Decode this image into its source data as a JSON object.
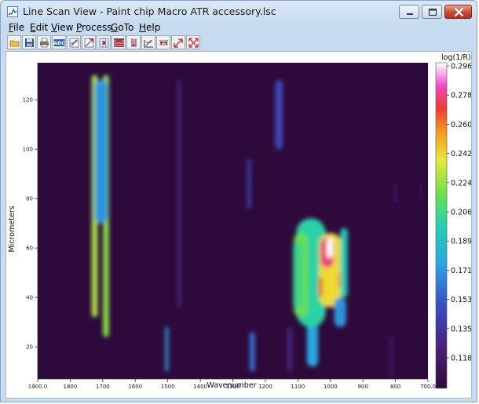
{
  "window": {
    "title": "Line Scan View - Paint chip Macro ATR accessory.lsc",
    "controls": [
      "minimize",
      "maximize",
      "close"
    ]
  },
  "menu": [
    {
      "label": "File",
      "mnemonic": "F",
      "rest": "ile"
    },
    {
      "label": "Edit",
      "mnemonic": "E",
      "rest": "dit"
    },
    {
      "label": "View",
      "mnemonic": "V",
      "rest": "iew"
    },
    {
      "label": "Process",
      "mnemonic": "P",
      "rest": "rocess"
    },
    {
      "label": "GoTo",
      "mnemonic": "G",
      "rest": "oTo"
    },
    {
      "label": "Help",
      "mnemonic": "H",
      "rest": "elp"
    }
  ],
  "toolbar": {
    "buttons": [
      "open-folder-icon",
      "save-disk-icon",
      "print-icon",
      "abc-label-icon",
      "edit-spectrum-icon",
      "zoom-window-icon",
      "grid-icon",
      "image-map-icon",
      "vertical-cursor-icon",
      "horizontal-cursor-icon",
      "axis-scale-icon",
      "horizontal-expand-icon",
      "zoom-out-icon",
      "full-scale-icon"
    ]
  },
  "chart_data": {
    "type": "heatmap",
    "xlabel": "Wavenumber",
    "ylabel": "Micrometers",
    "xlim": [
      1900.0,
      700.0
    ],
    "ylim": [
      7,
      135
    ],
    "x_ticks": [
      "1900.0",
      "1800",
      "1700",
      "1600",
      "1500",
      "1400",
      "1300",
      "1200",
      "1100",
      "1000",
      "900",
      "800",
      "700.0"
    ],
    "y_ticks": [
      20,
      40,
      60,
      80,
      100,
      120
    ],
    "grid": false,
    "colorbar": {
      "title": "log(1/R)",
      "ticks": [
        "0.296",
        "0.278",
        "0.260",
        "0.242",
        "0.224",
        "0.206",
        "0.189",
        "0.171",
        "0.153",
        "0.135",
        "0.118"
      ],
      "min": 0.1,
      "max": 0.296
    },
    "background_value": 0.1,
    "features": [
      {
        "wavenumber": 1725,
        "width": 18,
        "y_from": 32,
        "y_to": 130,
        "value": 0.228
      },
      {
        "wavenumber": 1690,
        "width": 18,
        "y_from": 24,
        "y_to": 130,
        "value": 0.222
      },
      {
        "wavenumber": 1705,
        "width": 40,
        "y_from": 70,
        "y_to": 128,
        "value": 0.17
      },
      {
        "wavenumber": 1465,
        "width": 8,
        "y_from": 36,
        "y_to": 128,
        "value": 0.13
      },
      {
        "wavenumber": 1503,
        "width": 9,
        "y_from": 10,
        "y_to": 28,
        "value": 0.175
      },
      {
        "wavenumber": 1240,
        "width": 16,
        "y_from": 10,
        "y_to": 26,
        "value": 0.16
      },
      {
        "wavenumber": 1250,
        "width": 10,
        "y_from": 76,
        "y_to": 96,
        "value": 0.145
      },
      {
        "wavenumber": 1158,
        "width": 24,
        "y_from": 100,
        "y_to": 128,
        "value": 0.145
      },
      {
        "wavenumber": 1125,
        "width": 12,
        "y_from": 10,
        "y_to": 28,
        "value": 0.13
      },
      {
        "wavenumber": 1055,
        "width": 34,
        "y_from": 12,
        "y_to": 48,
        "value": 0.175
      },
      {
        "wavenumber": 1060,
        "width": 90,
        "y_from": 28,
        "y_to": 72,
        "value": 0.2
      },
      {
        "wavenumber": 1090,
        "width": 45,
        "y_from": 32,
        "y_to": 66,
        "value": 0.215
      },
      {
        "wavenumber": 1000,
        "width": 70,
        "y_from": 36,
        "y_to": 66,
        "value": 0.24
      },
      {
        "wavenumber": 1010,
        "width": 40,
        "y_from": 52,
        "y_to": 64,
        "value": 0.275
      },
      {
        "wavenumber": 1002,
        "width": 18,
        "y_from": 56,
        "y_to": 64,
        "value": 0.296
      },
      {
        "wavenumber": 1030,
        "width": 12,
        "y_from": 40,
        "y_to": 48,
        "value": 0.262
      },
      {
        "wavenumber": 970,
        "width": 16,
        "y_from": 44,
        "y_to": 50,
        "value": 0.255
      },
      {
        "wavenumber": 958,
        "width": 22,
        "y_from": 40,
        "y_to": 68,
        "value": 0.195
      },
      {
        "wavenumber": 1100,
        "width": 28,
        "y_from": 36,
        "y_to": 62,
        "value": 0.205
      },
      {
        "wavenumber": 970,
        "width": 36,
        "y_from": 28,
        "y_to": 40,
        "value": 0.17
      },
      {
        "wavenumber": 812,
        "width": 6,
        "y_from": 8,
        "y_to": 24,
        "value": 0.125
      },
      {
        "wavenumber": 800,
        "width": 5,
        "y_from": 78,
        "y_to": 86,
        "value": 0.12
      },
      {
        "wavenumber": 722,
        "width": 6,
        "y_from": 80,
        "y_to": 86,
        "value": 0.115
      }
    ]
  }
}
